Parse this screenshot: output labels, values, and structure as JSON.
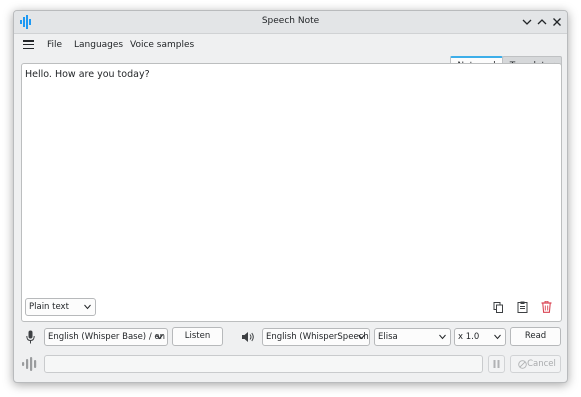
{
  "window": {
    "title": "Speech Note"
  },
  "menu": {
    "file": "File",
    "languages": "Languages",
    "voice_samples": "Voice samples"
  },
  "tabs": [
    {
      "label": "Notepad",
      "active": true
    },
    {
      "label": "Translator",
      "active": false
    }
  ],
  "editor": {
    "text": "Hello. How are you today?"
  },
  "format": {
    "selected": "Plain text"
  },
  "stt": {
    "model": "English (Whisper Base) / en",
    "listen_label": "Listen"
  },
  "tts": {
    "model": "English (WhisperSpeech",
    "voice": "Elisa",
    "speed": "x 1.0",
    "read_label": "Read"
  },
  "cancel": {
    "label": "Cancel"
  },
  "colors": {
    "accent": "#3daee9",
    "delete": "#da4453",
    "icon": "#3d4043",
    "brand": "#1d99f3"
  }
}
